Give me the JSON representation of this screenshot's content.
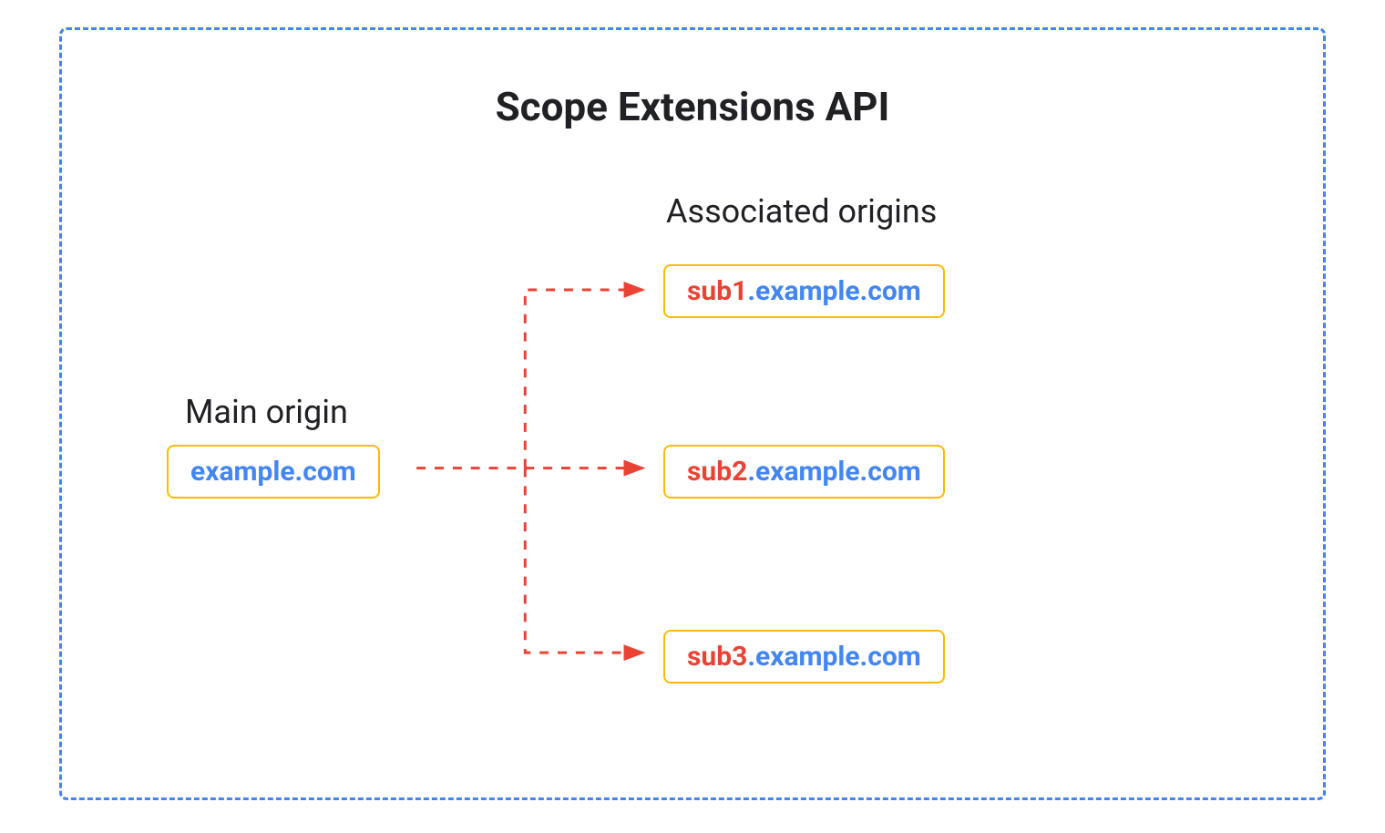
{
  "title": "Scope Extensions API",
  "main_origin": {
    "label": "Main origin",
    "domain": "example.com"
  },
  "associated_origins": {
    "label": "Associated origins",
    "items": [
      {
        "prefix": "sub1",
        "suffix": ".example.com"
      },
      {
        "prefix": "sub2",
        "suffix": ".example.com"
      },
      {
        "prefix": "sub3",
        "suffix": ".example.com"
      }
    ]
  },
  "colors": {
    "border_dash": "#4285F4",
    "box_border": "#FBBC05",
    "arrow": "#EA4335",
    "prefix": "#EA4335",
    "domain": "#4285F4",
    "text": "#202124"
  }
}
